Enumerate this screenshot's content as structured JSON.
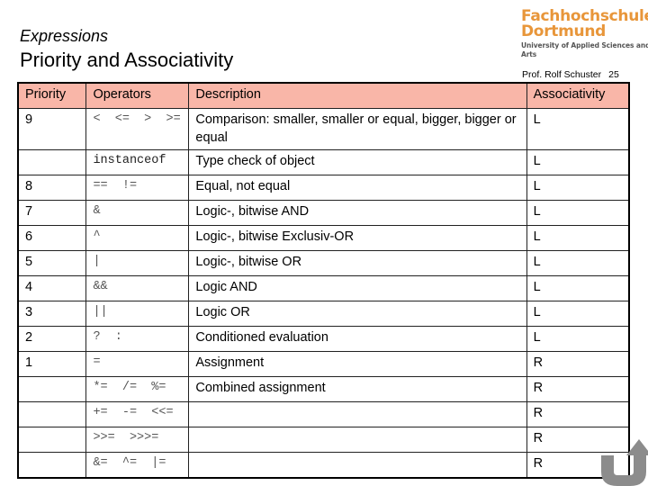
{
  "header": {
    "subtitle": "Expressions",
    "title": "Priority and Associativity",
    "author": "Prof. Rolf Schuster",
    "page_number": "25"
  },
  "logo": {
    "line1": "Fachhochschule",
    "line2": "Dortmund",
    "line3": "University of Applied Sciences and Arts",
    "color": "#e8963a"
  },
  "table": {
    "header_color": "#f9b6a8",
    "columns": [
      "Priority",
      "Operators",
      "Description",
      "Associativity"
    ],
    "rows": [
      {
        "priority": "9",
        "operators": "<  <=  >  >=",
        "description": "Comparison: smaller, smaller or equal, bigger, bigger or equal",
        "associativity": "L"
      },
      {
        "priority": "",
        "operators": "instanceof",
        "description": "Type check of object",
        "associativity": "L"
      },
      {
        "priority": "8",
        "operators": "==  !=",
        "description": "Equal, not equal",
        "associativity": "L"
      },
      {
        "priority": "7",
        "operators": "&",
        "description": "Logic-, bitwise AND",
        "associativity": "L"
      },
      {
        "priority": "6",
        "operators": "^",
        "description": "Logic-, bitwise Exclusiv-OR",
        "associativity": "L"
      },
      {
        "priority": "5",
        "operators": "|",
        "description": "Logic-, bitwise OR",
        "associativity": "L"
      },
      {
        "priority": "4",
        "operators": "&&",
        "description": "Logic AND",
        "associativity": "L"
      },
      {
        "priority": "3",
        "operators": "||",
        "description": "Logic OR",
        "associativity": "L"
      },
      {
        "priority": "2",
        "operators": "?  :",
        "description": "Conditioned evaluation",
        "associativity": "L"
      },
      {
        "priority": "1",
        "operators": "=",
        "description": "Assignment",
        "associativity": "R"
      },
      {
        "priority": "",
        "operators": "*=  /=  %=",
        "description": "Combined assignment",
        "associativity": "R"
      },
      {
        "priority": "",
        "operators": "+=  -=  <<=",
        "description": "",
        "associativity": "R"
      },
      {
        "priority": "",
        "operators": ">>=  >>>=",
        "description": "",
        "associativity": "R"
      },
      {
        "priority": "",
        "operators": "&=  ^=  |=",
        "description": "",
        "associativity": "R"
      }
    ]
  },
  "icons": {
    "undo": "undo-arrow-icon"
  }
}
